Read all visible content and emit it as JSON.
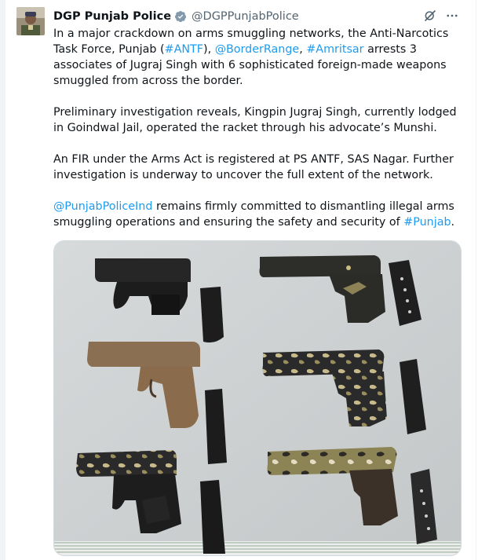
{
  "tweet": {
    "display_name": "DGP Punjab Police",
    "handle": "@DGPPunjabPolice",
    "p1": {
      "t1": "In a major crackdown on arms smuggling networks, the Anti-Narcotics Task Force, Punjab (",
      "l1": "#ANTF",
      "t2": "), ",
      "l2": "@BorderRange",
      "t3": ", ",
      "l3": "#Amritsar",
      "t4": " arrests 3 associates of Jugraj Singh with 6 sophisticated foreign-made weapons smuggled from across the border."
    },
    "p2": "Preliminary investigation reveals, Kingpin Jugraj Singh, currently lodged in Goindwal Jail, operated the racket through his advocate’s Munshi.",
    "p3": "An FIR under the Arms Act is registered at PS ANTF, SAS Nagar. Further investigation is underway to uncover the full extent of the network.",
    "p4": {
      "l1": "@PunjabPoliceInd",
      "t1": " remains firmly committed to dismantling illegal arms smuggling operations and ensuring the safety and security of ",
      "l2": "#Punjab",
      "t2": "."
    }
  },
  "icons": {
    "verified": "verified-badge-icon",
    "grok": "grok-icon",
    "more": "more-icon"
  },
  "colors": {
    "link": "#1d9bf0",
    "handle": "#536471",
    "text": "#0f1419"
  }
}
